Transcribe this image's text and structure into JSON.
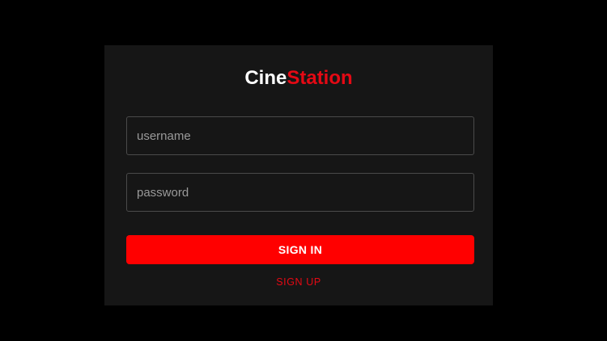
{
  "brand": {
    "name_part1": "Cine",
    "name_part2": "Station",
    "accent_color": "#e50914"
  },
  "form": {
    "username_placeholder": "username",
    "username_value": "",
    "password_placeholder": "password",
    "password_value": "",
    "signin_label": "SIGN IN",
    "signup_label": "SIGN UP"
  },
  "colors": {
    "page_background": "#000000",
    "card_background": "#161616",
    "primary_button": "#ff0000",
    "field_border": "#4a4a4a"
  }
}
